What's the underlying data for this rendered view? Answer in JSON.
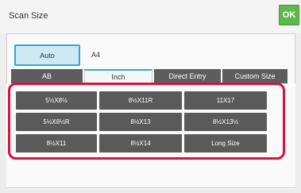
{
  "header": {
    "title": "Scan Size",
    "ok_label": "OK"
  },
  "auto": {
    "label": "Auto",
    "value": "A4"
  },
  "tabs": [
    {
      "label": "AB",
      "active": false
    },
    {
      "label": "Inch",
      "active": true
    },
    {
      "label": "Direct Entry",
      "active": false
    },
    {
      "label": "Custom Size",
      "active": false
    }
  ],
  "sizes": [
    [
      "5½X8½",
      "8½X11R",
      "11X17"
    ],
    [
      "5½X8½R",
      "8½X13",
      "8½X13½"
    ],
    [
      "8½X11",
      "8½X14",
      "Long Size"
    ]
  ],
  "colors": {
    "accent": "#35a6cf",
    "ok": "#5fb84e",
    "highlight": "#d8133e",
    "button": "#5a5a5a"
  }
}
